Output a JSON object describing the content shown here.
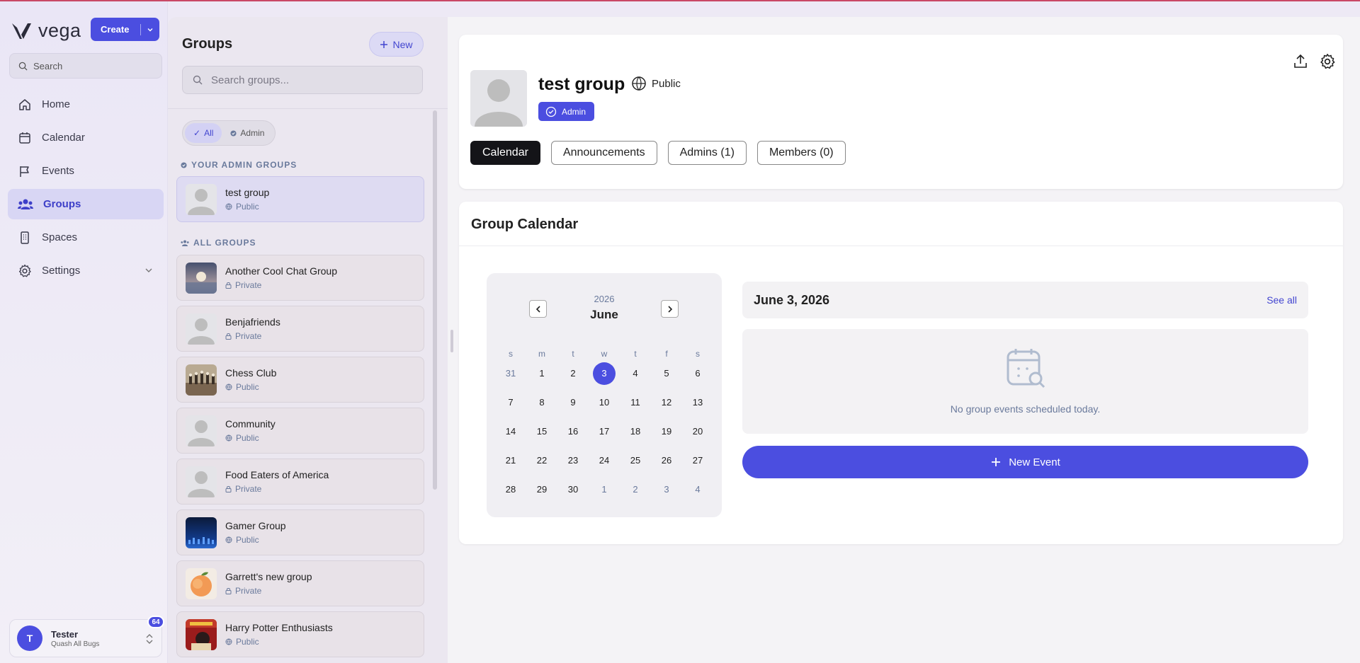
{
  "app": {
    "brand": "vega",
    "create_label": "Create"
  },
  "nav": {
    "search_placeholder": "Search",
    "items": [
      {
        "label": "Home",
        "icon": "home-icon"
      },
      {
        "label": "Calendar",
        "icon": "calendar-icon"
      },
      {
        "label": "Events",
        "icon": "flag-icon"
      },
      {
        "label": "Groups",
        "icon": "users-icon",
        "active": true
      },
      {
        "label": "Spaces",
        "icon": "building-icon"
      },
      {
        "label": "Settings",
        "icon": "gear-icon"
      }
    ],
    "user": {
      "initial": "T",
      "name": "Tester",
      "subtitle": "Quash All Bugs",
      "badge": "64"
    }
  },
  "groups_panel": {
    "title": "Groups",
    "new_label": "New",
    "search_placeholder": "Search groups...",
    "filters": [
      {
        "label": "All",
        "active": true
      },
      {
        "label": "Admin",
        "active": false
      }
    ],
    "admin_section_label": "YOUR ADMIN GROUPS",
    "all_section_label": "ALL GROUPS",
    "admin_groups": [
      {
        "name": "test group",
        "visibility": "Public",
        "thumb": "default-avatar"
      }
    ],
    "all_groups": [
      {
        "name": "Another Cool Chat Group",
        "visibility": "Private",
        "thumb": "moon-photo"
      },
      {
        "name": "Benjafriends",
        "visibility": "Private",
        "thumb": "default-avatar"
      },
      {
        "name": "Chess Club",
        "visibility": "Public",
        "thumb": "chess-photo"
      },
      {
        "name": "Community",
        "visibility": "Public",
        "thumb": "default-avatar"
      },
      {
        "name": "Food Eaters of America",
        "visibility": "Private",
        "thumb": "default-avatar"
      },
      {
        "name": "Gamer Group",
        "visibility": "Public",
        "thumb": "night-city-photo"
      },
      {
        "name": "Garrett's new group",
        "visibility": "Private",
        "thumb": "peach-photo"
      },
      {
        "name": "Harry Potter Enthusiasts",
        "visibility": "Public",
        "thumb": "book-cover-photo"
      }
    ]
  },
  "group": {
    "title": "test group",
    "visibility": "Public",
    "role_badge": "Admin",
    "tabs": [
      {
        "label": "Calendar",
        "active": true
      },
      {
        "label": "Announcements",
        "active": false
      },
      {
        "label": "Admins (1)",
        "active": false
      },
      {
        "label": "Members (0)",
        "active": false
      }
    ]
  },
  "calendar": {
    "section_title": "Group Calendar",
    "year": "2026",
    "month": "June",
    "weekdays": [
      "s",
      "m",
      "t",
      "w",
      "t",
      "f",
      "s"
    ],
    "weeks": [
      [
        "31",
        "1",
        "2",
        "3",
        "4",
        "5",
        "6"
      ],
      [
        "7",
        "8",
        "9",
        "10",
        "11",
        "12",
        "13"
      ],
      [
        "14",
        "15",
        "16",
        "17",
        "18",
        "19",
        "20"
      ],
      [
        "21",
        "22",
        "23",
        "24",
        "25",
        "26",
        "27"
      ],
      [
        "28",
        "29",
        "30",
        "1",
        "2",
        "3",
        "4"
      ]
    ],
    "selected_day": "3",
    "selected_date_label": "June 3, 2026",
    "see_all_label": "See all",
    "empty_message": "No group events scheduled today.",
    "new_event_label": "New Event"
  },
  "colors": {
    "accent": "#4b4ee0",
    "muted_text": "#6a7a9c",
    "active_tab": "#141418"
  }
}
